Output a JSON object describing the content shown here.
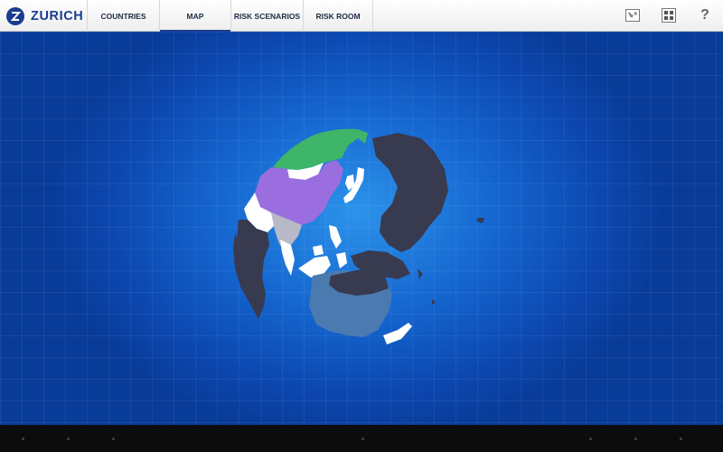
{
  "app": {
    "brand": "ZURICH"
  },
  "tabs": [
    {
      "label": "COUNTRIES",
      "active": false
    },
    {
      "label": "MAP",
      "active": true
    },
    {
      "label": "RISK SCENARIOS",
      "active": false
    },
    {
      "label": "RISK ROOM",
      "active": false
    }
  ],
  "toolbar": {
    "help_label": "?"
  },
  "icons": [
    "world-map-icon",
    "grid-icon",
    "help-icon"
  ],
  "colors": {
    "brand": "#1a3d8f",
    "ocean": "#1566d0",
    "land_default": "#383a4f",
    "highlight_purple": "#9b6ee0",
    "highlight_green": "#3fb56a",
    "highlight_steel": "#4a7ab0",
    "land_white": "#ffffff"
  }
}
